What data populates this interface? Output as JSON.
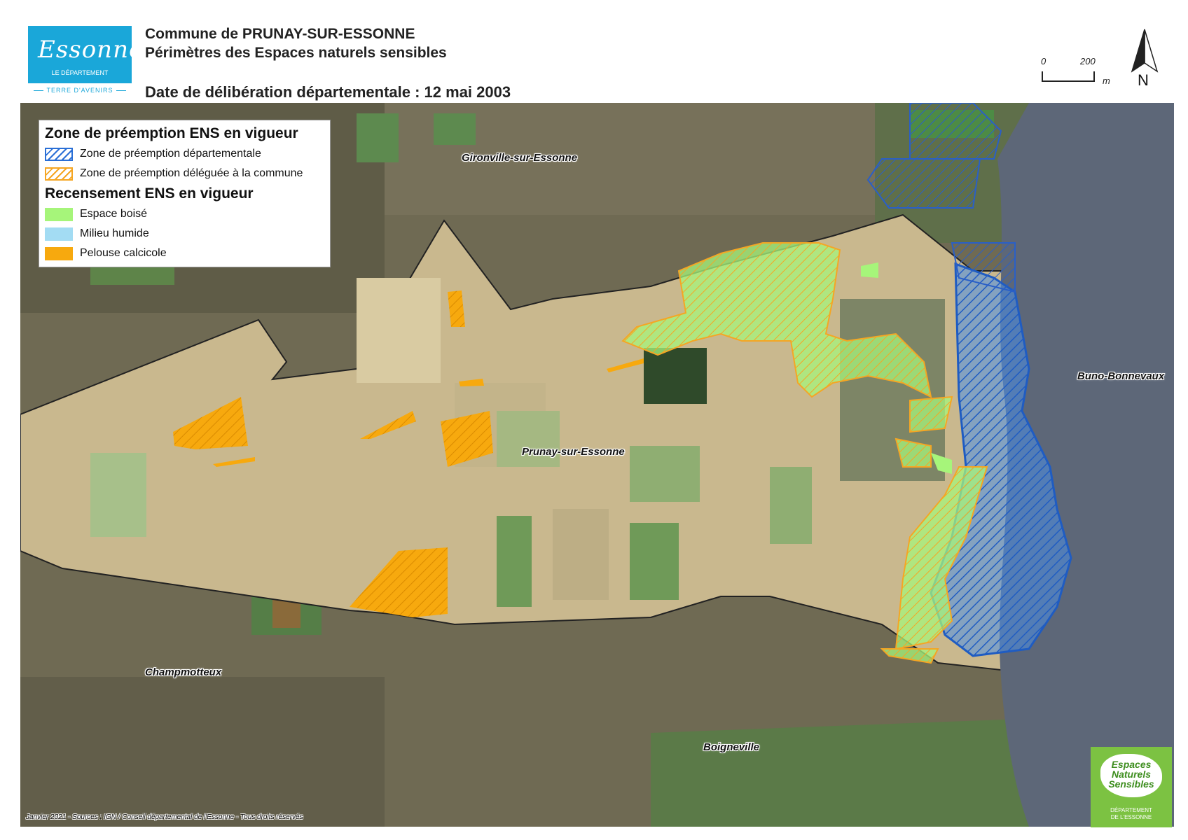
{
  "header": {
    "logo_script": "Essonne",
    "logo_subtitle": "LE DÉPARTEMENT",
    "logo_tagline": "TERRE D'AVENIRS",
    "title_line1": "Commune de PRUNAY-SUR-ESSONNE",
    "title_line2": "Périmètres des Espaces naturels sensibles",
    "title_line3": "Date de délibération départementale : 12 mai 2003"
  },
  "scale_bar": {
    "start": "0",
    "end": "200",
    "unit": "m"
  },
  "north_arrow": {
    "label": "N"
  },
  "legend": {
    "heading_zones": "Zone de préemption ENS en vigueur",
    "zone_departementale": "Zone de préemption départementale",
    "zone_deleguee": "Zone de préemption déléguée à la commune",
    "heading_recensement": "Recensement ENS en vigueur",
    "espace_boise": "Espace boisé",
    "milieu_humide": "Milieu humide",
    "pelouse_calcicole": "Pelouse calcicole"
  },
  "places": {
    "gironville": "Gironville-sur-Essonne",
    "prunay": "Prunay-sur-Essonne",
    "buno": "Buno-Bonnevaux",
    "champmotteux": "Champmotteux",
    "boigneville": "Boigneville"
  },
  "credits": "Janvier 2021 - Sources : IGN / Conseil départemental de l'Essonne - Tous droits réservés",
  "ens_logo": {
    "line1": "Espaces",
    "line2": "Naturels",
    "line3": "Sensibles",
    "sub1": "DÉPARTEMENT",
    "sub2": "DE L'ESSONNE"
  },
  "colors": {
    "zone_departementale": "#2a6fd6",
    "zone_deleguee": "#f5a623",
    "espace_boise": "#a6f57a",
    "milieu_humide": "#a3dcf3",
    "pelouse_calcicole": "#f7a90e",
    "essonne_blue": "#1aa7d9",
    "ens_green": "#7cc242"
  },
  "icons": [
    "north-arrow-icon",
    "scale-bar-icon"
  ]
}
